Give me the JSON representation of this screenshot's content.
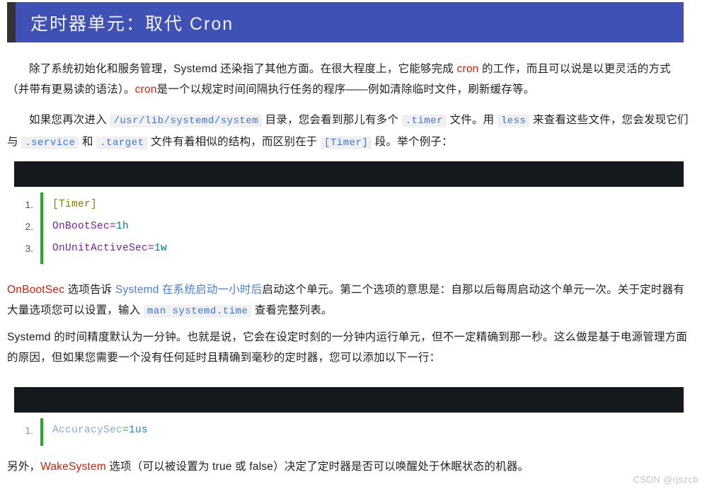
{
  "title": {
    "text": "定时器单元：取代 Cron",
    "accent_color": "#3f51b5",
    "bar_color": "#333333"
  },
  "paragraphs": {
    "p1": {
      "seg1": "除了系统初始化和服务管理，Systemd 还染指了其他方面。在很大程度上，它能够完成 ",
      "code1": "cron",
      "seg2": " 的工作，而且可以说是以更灵活的方式（并带有更易读的语法）。",
      "code2": "cron",
      "seg3": "是一个以规定时间间隔执行任务的程序——例如清除临时文件，刷新缓存等。"
    },
    "p2": {
      "seg1": "如果您再次进入 ",
      "code1": "/usr/lib/systemd/system",
      "seg2": " 目录，您会看到那儿有多个 ",
      "code2": ".timer",
      "seg3": " 文件。用 ",
      "code3": "less",
      "seg4": " 来查看这些文件，您会发现它们与 ",
      "code4": ".service",
      "seg5": " 和 ",
      "code5": ".target",
      "seg6": " 文件有着相似的结构，而区别在于 ",
      "code6": "[Timer]",
      "seg7": " 段。举个例子："
    },
    "p3": {
      "seg1": "OnBootSec",
      "seg2": " 选项告诉 ",
      "seg3": "Systemd 在系统启动一小时后",
      "seg4": "启动这个单元。第二个选项的意思是：自那以后每周启动这个单元一次。关于定时器有大量选项您可以设置，输入 ",
      "code1": "man systemd.time",
      "seg5": " 查看完整列表。"
    },
    "p4": {
      "seg1": "Systemd 的时间精度默认为一分钟。也就是说，它会在设定时刻的一分钟内运行单元，但不一定精确到那一秒。这么做是基于电源管理方面的原因，但如果您需要一个没有任何延时且精确到毫秒的定时器，您可以添加以下一行："
    },
    "p5": {
      "seg1": "另外，",
      "seg2": "WakeSystem",
      "seg3": " 选项（可以被设置为 true 或 false）决定了定时器是否可以唤醒处于休眠状态的机器。"
    }
  },
  "code_blocks": [
    {
      "id": "code-block-1",
      "header_color": "#15191e",
      "gutter_color": "#22aa22",
      "lines": [
        {
          "num": "1.",
          "section": "[Timer]",
          "key": "",
          "eq": "",
          "val": ""
        },
        {
          "num": "2.",
          "section": "",
          "key": "OnBootSec",
          "eq": "=",
          "val": "1h"
        },
        {
          "num": "3.",
          "section": "",
          "key": "OnUnitActiveSec",
          "eq": "=",
          "val": "1w"
        }
      ]
    },
    {
      "id": "code-block-2",
      "header_color": "#15191e",
      "gutter_color": "#22aa22",
      "lines": [
        {
          "num": "1.",
          "section": "",
          "key": "AccuracySec",
          "eq": "=",
          "val": "1us"
        }
      ]
    }
  ],
  "watermark": "CSDN @rjszcb"
}
